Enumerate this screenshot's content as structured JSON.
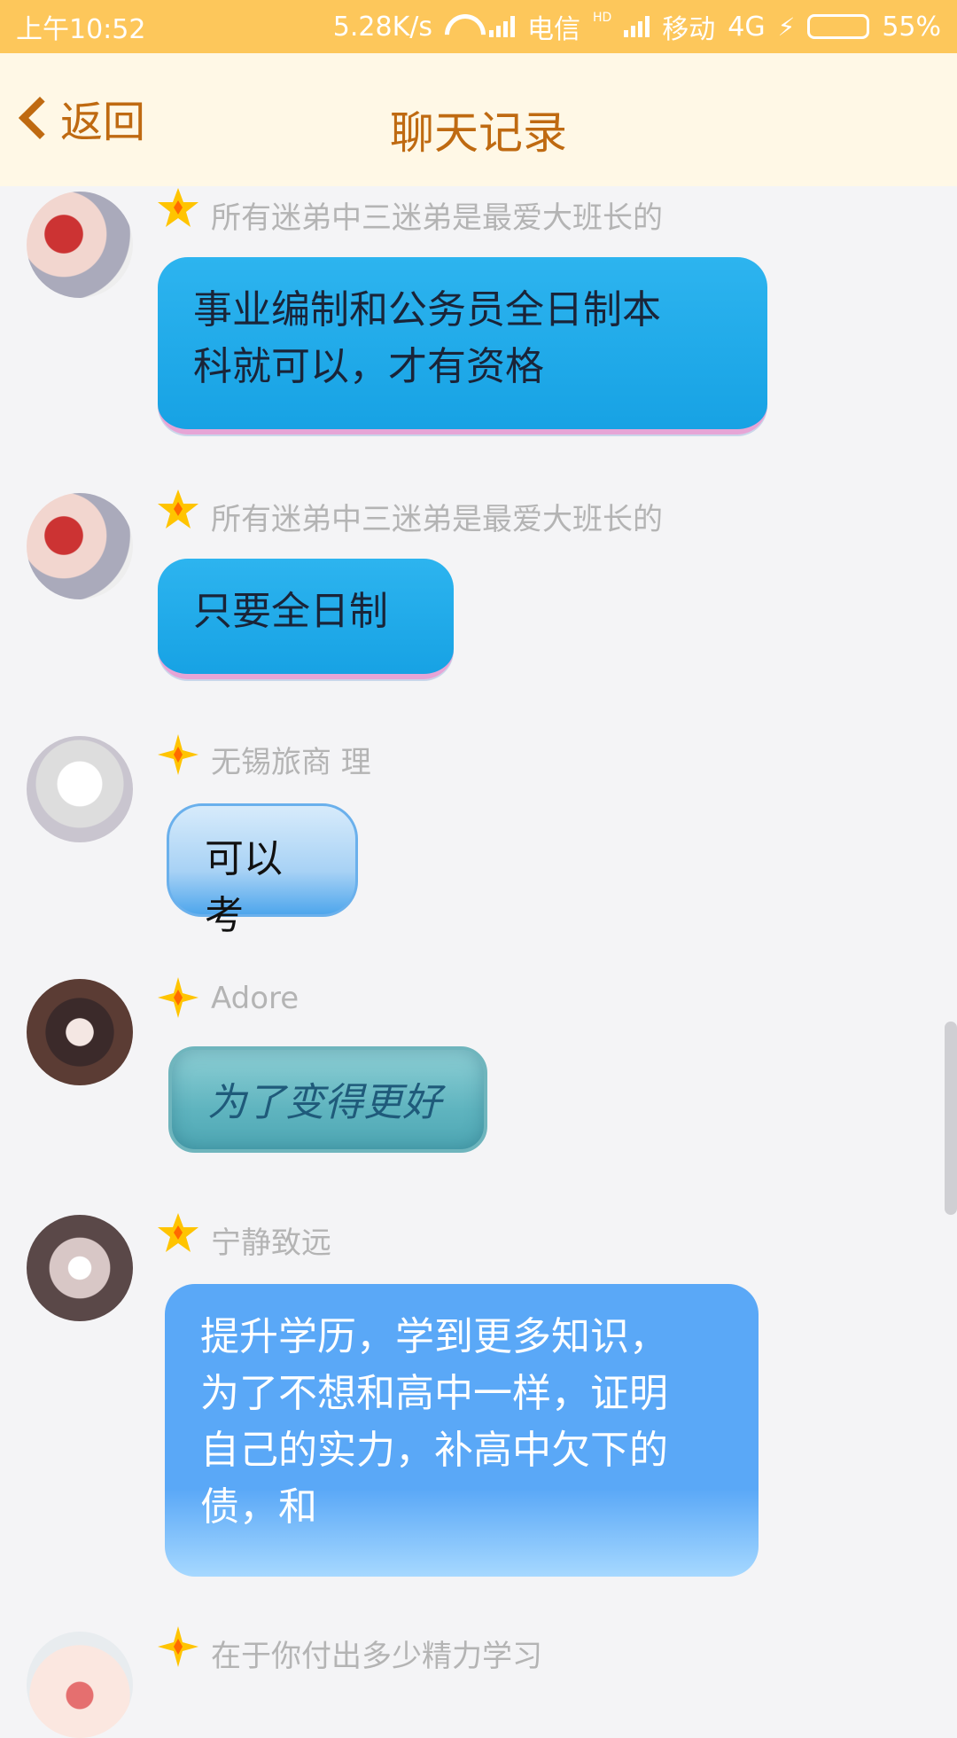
{
  "status_bar": {
    "time": "上午10:52",
    "net_speed": "5.28K/s",
    "carrier1": "电信",
    "hd_badge": "HD",
    "carrier2": "移动",
    "network_type": "4G",
    "battery_percent": "55%",
    "battery_level": 0.55,
    "bar_color": "#fdc75b"
  },
  "header": {
    "back_label": "返回",
    "title": "聊天记录",
    "accent_color": "#bf6a11",
    "background": "#fff8e6"
  },
  "messages": [
    {
      "sender": "所有迷弟中三迷弟是最爱大班长的",
      "text": "事业编制和公务员全日制本\n科就可以，才有资格",
      "avatar_icon": "couple-anime-avatar",
      "badge_icon": "star-badge-icon"
    },
    {
      "sender": "所有迷弟中三迷弟是最爱大班长的",
      "text": "只要全日制",
      "avatar_icon": "couple-anime-avatar",
      "badge_icon": "star-badge-icon"
    },
    {
      "sender": "无锡旅商 理",
      "text": "可以考",
      "avatar_icon": "sketch-boy-avatar",
      "badge_icon": "diamond-badge-icon"
    },
    {
      "sender": "Adore",
      "text": "为了变得更好",
      "avatar_icon": "girl-photo-avatar",
      "badge_icon": "diamond-badge-icon"
    },
    {
      "sender": "宁静致远",
      "text": "提升学历，学到更多知识，\n为了不想和高中一样，证明\n自己的实力，补高中欠下的\n债，和",
      "avatar_icon": "girl-white-dress-avatar",
      "badge_icon": "star-badge-icon"
    },
    {
      "sender": "在于你付出多少精力学习",
      "text": "",
      "avatar_icon": "cartoon-face-avatar",
      "badge_icon": "diamond-badge-icon"
    }
  ]
}
